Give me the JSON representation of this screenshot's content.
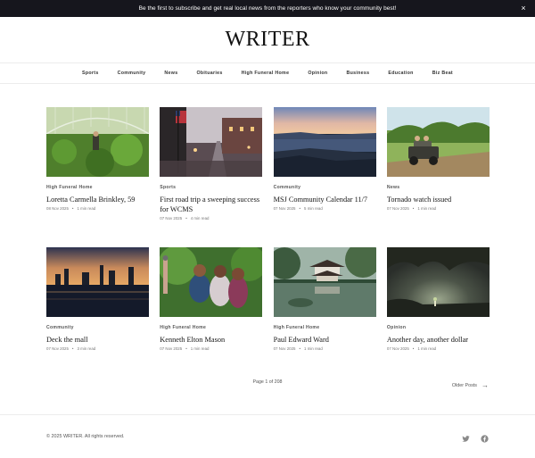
{
  "announcement": {
    "text": "Be the first to subscribe and get real local news from the reporters who know your community best!",
    "close_label": "×"
  },
  "masthead": {
    "logo": "WRITER"
  },
  "nav": {
    "items": [
      "Sports",
      "Community",
      "News",
      "Obituaries",
      "High Funeral Home",
      "Opinion",
      "Business",
      "Education",
      "Biz Beat"
    ]
  },
  "posts": [
    {
      "category": "High Funeral Home",
      "title": "Loretta Carmella Brinkley, 59",
      "date": "08 Nov 2025",
      "read": "1 min read",
      "image": "greenhouse"
    },
    {
      "category": "Sports",
      "title": "First road trip a sweeping success for WCMS",
      "date": "07 Nov 2025",
      "read": "4 min read",
      "image": "street-dusk"
    },
    {
      "category": "Community",
      "title": "MSJ Community Calendar 11/7",
      "date": "07 Nov 2025",
      "read": "5 min read",
      "image": "coast-sunset"
    },
    {
      "category": "News",
      "title": "Tornado watch issued",
      "date": "07 Nov 2025",
      "read": "1 min read",
      "image": "atv-field"
    },
    {
      "category": "Community",
      "title": "Deck the mall",
      "date": "07 Nov 2025",
      "read": "3 min read",
      "image": "city-skyline"
    },
    {
      "category": "High Funeral Home",
      "title": "Kenneth Elton Mason",
      "date": "07 Nov 2025",
      "read": "1 min read",
      "image": "friends-selfie"
    },
    {
      "category": "High Funeral Home",
      "title": "Paul Edward Ward",
      "date": "07 Nov 2025",
      "read": "1 min read",
      "image": "pagoda-pond"
    },
    {
      "category": "Opinion",
      "title": "Another day, another dollar",
      "date": "07 Nov 2025",
      "read": "1 min read",
      "image": "cave"
    }
  ],
  "pagination": {
    "text": "Page 1 of 208",
    "older_label": "Older Posts"
  },
  "footer": {
    "copyright": "© 2025 WRITER. All rights reserved.",
    "social": [
      "twitter-icon",
      "facebook-icon"
    ]
  }
}
